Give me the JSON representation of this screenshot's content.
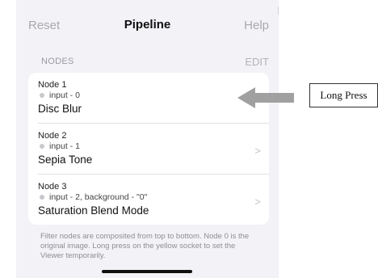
{
  "navbar": {
    "reset_label": "Reset",
    "title": "Pipeline",
    "help_label": "Help"
  },
  "section": {
    "header": "NODES",
    "edit_label": "EDIT"
  },
  "nodes": [
    {
      "title": "Node 1",
      "input": "input - 0",
      "name": "Disc Blur",
      "chevron": ""
    },
    {
      "title": "Node 2",
      "input": "input - 1",
      "name": "Sepia Tone",
      "chevron": ">"
    },
    {
      "title": "Node 3",
      "input": "input - 2, background - \"0\"",
      "name": "Saturation Blend Mode",
      "chevron": ">"
    }
  ],
  "footer": {
    "note": "Filter nodes are composited from top to bottom. Node 0 is the original image. Long press on the yellow socket to set the Viewer temporarily."
  },
  "annotation": {
    "label": "Long Press"
  },
  "colors": {
    "background": "#f2f2f7",
    "card": "#ffffff",
    "accent_gray": "#a9a9ae",
    "arrow": "#a0a0a0",
    "socket_dot": "#c7c7cc"
  },
  "icons": {
    "arrow": "left-arrow-icon",
    "chevron": "chevron-right-icon",
    "socket": "socket-dot-icon"
  }
}
